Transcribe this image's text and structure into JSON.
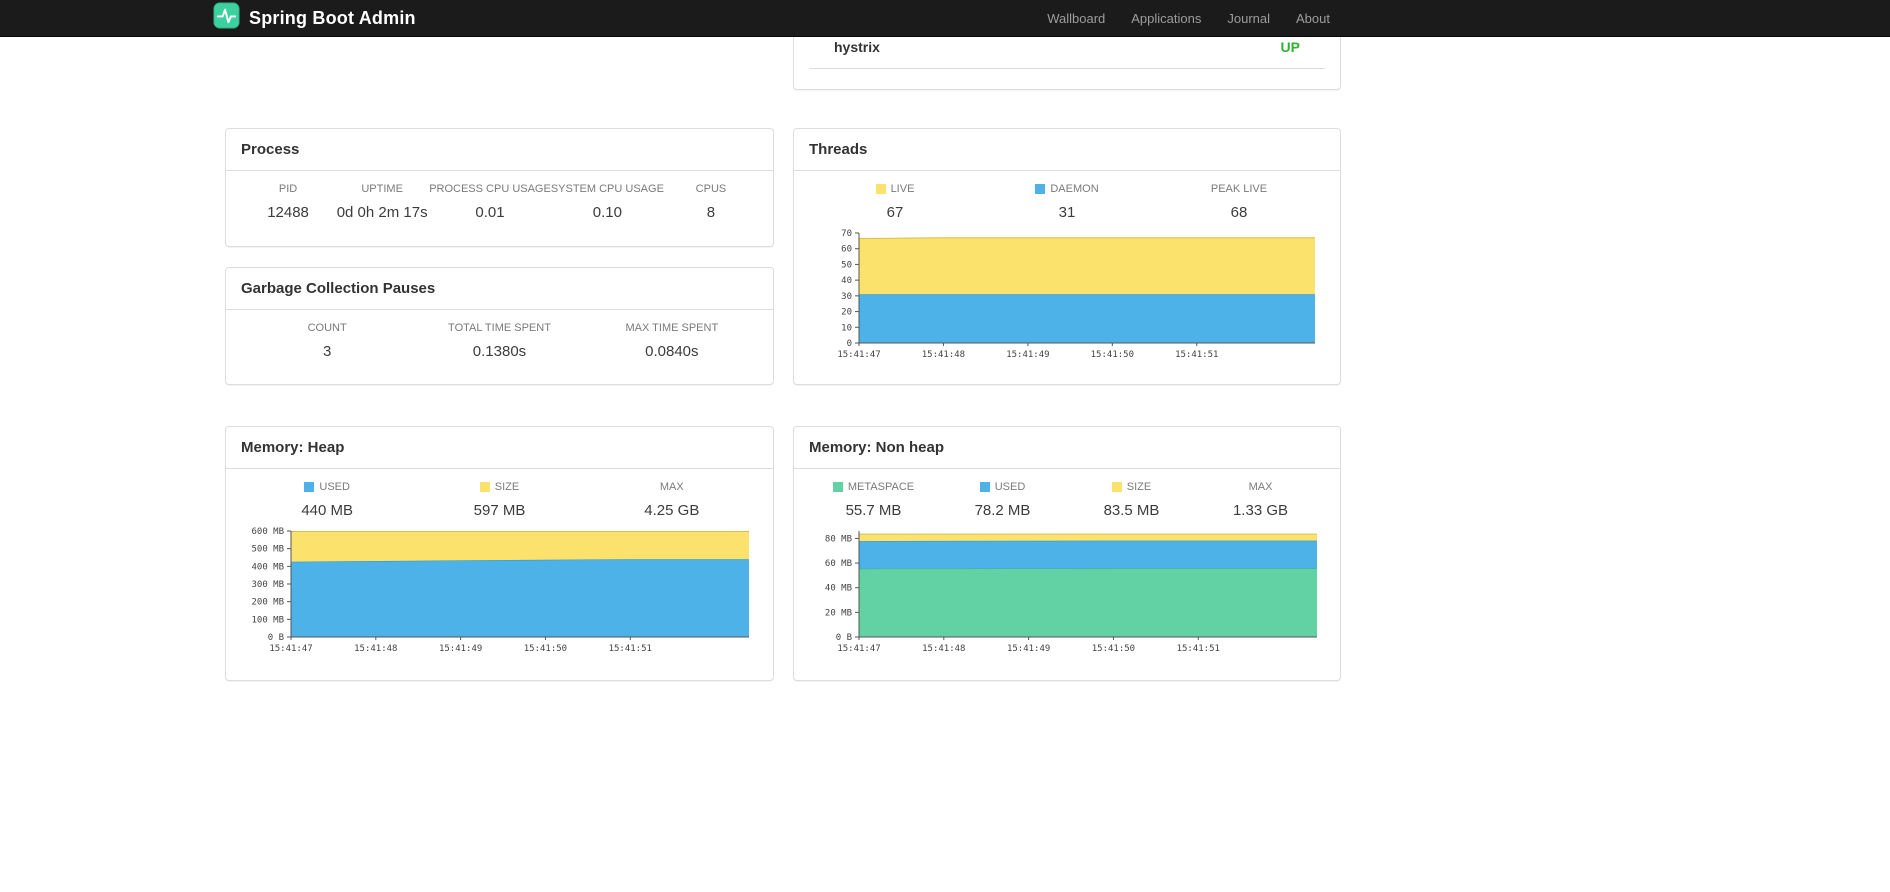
{
  "navbar": {
    "brand": "Spring Boot Admin",
    "brand_color": "#3ed1a0",
    "links": [
      {
        "label": "Wallboard"
      },
      {
        "label": "Applications"
      },
      {
        "label": "Journal"
      },
      {
        "label": "About"
      }
    ]
  },
  "applications_panel": {
    "rows": [
      {
        "name": "hystrix",
        "status": "UP",
        "status_color": "#2fb42f"
      }
    ]
  },
  "panels": {
    "process": {
      "title": "Process",
      "metrics": [
        {
          "label": "PID",
          "value": "12488"
        },
        {
          "label": "UPTIME",
          "value": "0d 0h 2m 17s"
        },
        {
          "label": "PROCESS CPU USAGE",
          "value": "0.01"
        },
        {
          "label": "SYSTEM CPU USAGE",
          "value": "0.10"
        },
        {
          "label": "CPUS",
          "value": "8"
        }
      ]
    },
    "gc": {
      "title": "Garbage Collection Pauses",
      "metrics": [
        {
          "label": "COUNT",
          "value": "3"
        },
        {
          "label": "TOTAL TIME SPENT",
          "value": "0.1380s"
        },
        {
          "label": "MAX TIME SPENT",
          "value": "0.0840s"
        }
      ]
    },
    "threads": {
      "title": "Threads",
      "metrics": [
        {
          "label": "LIVE",
          "value": "67",
          "swatch": "#FBE26D"
        },
        {
          "label": "DAEMON",
          "value": "31",
          "swatch": "#4CB2E8"
        },
        {
          "label": "PEAK LIVE",
          "value": "68"
        }
      ]
    },
    "heap": {
      "title": "Memory: Heap",
      "metrics": [
        {
          "label": "USED",
          "value": "440 MB",
          "swatch": "#4CB2E8"
        },
        {
          "label": "SIZE",
          "value": "597 MB",
          "swatch": "#FBE26D"
        },
        {
          "label": "MAX",
          "value": "4.25 GB"
        }
      ]
    },
    "nonheap": {
      "title": "Memory: Non heap",
      "metrics": [
        {
          "label": "METASPACE",
          "value": "55.7 MB",
          "swatch": "#62D2A4"
        },
        {
          "label": "USED",
          "value": "78.2 MB",
          "swatch": "#4CB2E8"
        },
        {
          "label": "SIZE",
          "value": "83.5 MB",
          "swatch": "#FBE26D"
        },
        {
          "label": "MAX",
          "value": "1.33 GB"
        }
      ]
    }
  },
  "chart_data": [
    {
      "name": "threads",
      "type": "area",
      "stacking": "absolute-tops",
      "x": [
        "15:41:47",
        "15:41:48",
        "15:41:49",
        "15:41:50",
        "15:41:51"
      ],
      "x_extent": 5.4,
      "ylim": [
        0,
        70
      ],
      "grid": false,
      "legend_position": "above",
      "yticks": [
        {
          "v": 0,
          "label": "0"
        },
        {
          "v": 10,
          "label": "10"
        },
        {
          "v": 20,
          "label": "20"
        },
        {
          "v": 30,
          "label": "30"
        },
        {
          "v": 40,
          "label": "40"
        },
        {
          "v": 50,
          "label": "50"
        },
        {
          "v": 60,
          "label": "60"
        },
        {
          "v": 70,
          "label": "70"
        }
      ],
      "series": [
        {
          "name": "DAEMON",
          "fill": "#4CB2E8",
          "stroke": "#2B94C9",
          "values": [
            31,
            31,
            31,
            31,
            31
          ]
        },
        {
          "name": "LIVE",
          "fill": "#FBE26D",
          "stroke": "#D8BE4B",
          "values": [
            66.5,
            67,
            67,
            67,
            67
          ]
        }
      ]
    },
    {
      "name": "memory-heap",
      "type": "area",
      "stacking": "absolute-tops",
      "x": [
        "15:41:47",
        "15:41:48",
        "15:41:49",
        "15:41:50",
        "15:41:51"
      ],
      "x_extent": 5.4,
      "ylim": [
        0,
        600
      ],
      "grid": false,
      "legend_position": "above",
      "yticks": [
        {
          "v": 0,
          "label": "0 B"
        },
        {
          "v": 100,
          "label": "100 MB"
        },
        {
          "v": 200,
          "label": "200 MB"
        },
        {
          "v": 300,
          "label": "300 MB"
        },
        {
          "v": 400,
          "label": "400 MB"
        },
        {
          "v": 500,
          "label": "500 MB"
        },
        {
          "v": 600,
          "label": "600 MB"
        }
      ],
      "series": [
        {
          "name": "USED",
          "fill": "#4CB2E8",
          "stroke": "#2B94C9",
          "values": [
            426,
            430,
            434,
            437,
            440
          ]
        },
        {
          "name": "SIZE",
          "fill": "#FBE26D",
          "stroke": "#D8BE4B",
          "values": [
            597,
            597,
            597,
            597,
            597
          ]
        }
      ]
    },
    {
      "name": "memory-nonheap",
      "type": "area",
      "stacking": "absolute-tops",
      "x": [
        "15:41:47",
        "15:41:48",
        "15:41:49",
        "15:41:50",
        "15:41:51"
      ],
      "x_extent": 5.4,
      "ylim": [
        0,
        86
      ],
      "grid": false,
      "legend_position": "above",
      "yticks": [
        {
          "v": 0,
          "label": "0 B"
        },
        {
          "v": 20,
          "label": "20 MB"
        },
        {
          "v": 40,
          "label": "40 MB"
        },
        {
          "v": 60,
          "label": "60 MB"
        },
        {
          "v": 80,
          "label": "80 MB"
        }
      ],
      "series": [
        {
          "name": "METASPACE",
          "fill": "#62D2A4",
          "stroke": "#39B488",
          "values": [
            55.4,
            55.5,
            55.6,
            55.7,
            55.7
          ]
        },
        {
          "name": "USED",
          "fill": "#4CB2E8",
          "stroke": "#2B94C9",
          "values": [
            77.8,
            78.0,
            78.1,
            78.2,
            78.2
          ]
        },
        {
          "name": "SIZE",
          "fill": "#FBE26D",
          "stroke": "#D8BE4B",
          "values": [
            83.5,
            83.5,
            83.5,
            83.5,
            83.5
          ]
        }
      ]
    }
  ]
}
